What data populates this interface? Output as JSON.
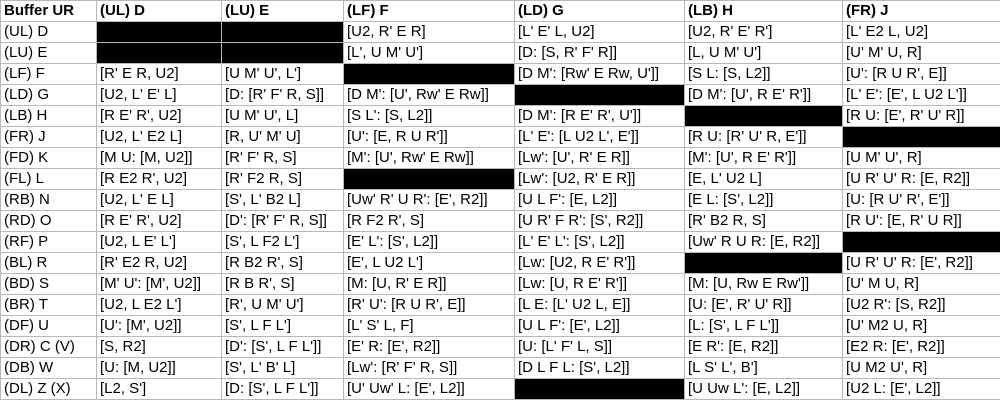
{
  "table": {
    "corner_label": "Buffer UR",
    "columns": [
      "(UL) D",
      "(LU) E",
      "(LF) F",
      "(LD) G",
      "(LB) H",
      "(FR) J"
    ],
    "rows": [
      {
        "label": "(UL) D",
        "cells": [
          null,
          null,
          "[U2, R' E R]",
          "[L' E' L, U2]",
          "[U2, R' E' R']",
          "[L' E2 L, U2]"
        ]
      },
      {
        "label": "(LU) E",
        "cells": [
          null,
          null,
          "[L', U M' U']",
          "[D: [S, R' F' R]]",
          "[L, U M' U']",
          "[U' M' U, R]"
        ]
      },
      {
        "label": "(LF) F",
        "cells": [
          "[R' E R, U2]",
          "[U M' U', L']",
          null,
          "[D M': [Rw' E Rw, U']]",
          "[S L: [S, L2]]",
          "[U': [R U R', E]]"
        ]
      },
      {
        "label": "(LD) G",
        "cells": [
          "[U2, L' E' L]",
          "[D: [R' F' R, S]]",
          "[D M': [U', Rw' E Rw]]",
          null,
          "[D M': [U', R E' R']]",
          "[L' E': [E', L U2 L']]"
        ]
      },
      {
        "label": "(LB) H",
        "cells": [
          "[R E' R', U2]",
          "[U M' U', L]",
          "[S L': [S, L2]]",
          "[D M': [R E' R', U']]",
          null,
          "[R U: [E', R' U' R]]"
        ]
      },
      {
        "label": "(FR) J",
        "cells": [
          "[U2, L' E2 L]",
          "[R, U' M' U]",
          "[U': [E, R U R']]",
          "[L' E': [L U2 L', E']]",
          "[R U: [R' U' R, E']]",
          null
        ]
      },
      {
        "label": "(FD) K",
        "cells": [
          "[M U: [M, U2]]",
          "[R' F' R, S]",
          "[M': [U', Rw' E Rw]]",
          "[Lw': [U', R' E R]]",
          "[M': [U', R E' R']]",
          "[U M' U', R]"
        ]
      },
      {
        "label": "(FL) L",
        "cells": [
          "[R E2 R', U2]",
          "[R' F2 R, S]",
          null,
          "[Lw': [U2, R' E R]]",
          "[E, L' U2 L]",
          "[U R' U' R: [E, R2]]"
        ]
      },
      {
        "label": "(RB) N",
        "cells": [
          "[U2, L' E L]",
          "[S', L' B2 L]",
          "[Uw' R' U R': [E', R2]]",
          "[U L F': [E, L2]]",
          "[E L: [S', L2]]",
          "[U: [R U' R', E']]"
        ]
      },
      {
        "label": "(RD) O",
        "cells": [
          "[R E' R', U2]",
          "[D': [R' F' R, S]]",
          "[R F2 R', S]",
          "[U R' F R': [S', R2]]",
          "[R' B2 R, S]",
          "[R U': [E, R' U R]]"
        ]
      },
      {
        "label": "(RF) P",
        "cells": [
          "[U2, L E' L']",
          "[S', L F2 L']",
          "[E' L': [S', L2]]",
          "[L' E' L': [S', L2]]",
          "[Uw' R U R: [E, R2]]",
          null
        ]
      },
      {
        "label": "(BL) R",
        "cells": [
          "[R' E2 R, U2]",
          "[R B2 R', S]",
          "[E', L U2 L']",
          "[Lw: [U2, R E' R']]",
          null,
          "[U R' U' R: [E', R2]]"
        ]
      },
      {
        "label": "(BD) S",
        "cells": [
          "[M' U': [M', U2]]",
          "[R B R', S]",
          "[M: [U, R' E R]]",
          "[Lw: [U, R E' R']]",
          "[M: [U, Rw E Rw']]",
          "[U' M U, R]"
        ]
      },
      {
        "label": "(BR) T",
        "cells": [
          "[U2, L E2 L']",
          "[R', U M' U']",
          "[R' U': [R U R', E]]",
          "[L E: [L' U2 L, E]]",
          "[U: [E', R' U' R]]",
          "[U2 R': [S, R2]]"
        ]
      },
      {
        "label": "(DF) U",
        "cells": [
          "[U': [M', U2]]",
          "[S', L F L']",
          "[L' S' L, F]",
          "[U L F': [E', L2]]",
          "[L: [S', L F L']]",
          "[U' M2 U, R]"
        ]
      },
      {
        "label": "(DR) C (V)",
        "cells": [
          "[S, R2]",
          "[D': [S', L F L']]",
          "[E' R: [E', R2]]",
          "[U: [L' F' L, S]]",
          "[E R': [E, R2]]",
          "[E2 R: [E', R2]]"
        ]
      },
      {
        "label": "(DB) W",
        "cells": [
          "[U: [M, U2]]",
          "[S', L' B' L]",
          "[Lw': [R' F' R, S]]",
          "[D L F L: [S', L2]]",
          "[L S' L', B']",
          "[U M2 U', R]"
        ]
      },
      {
        "label": "(DL) Z (X)",
        "cells": [
          "[L2, S']",
          "[D: [S', L F L']]",
          "[U' Uw' L: [E', L2]]",
          null,
          "[U Uw L': [E, L2]]",
          "[U2 L: [E', L2]]"
        ]
      }
    ]
  }
}
